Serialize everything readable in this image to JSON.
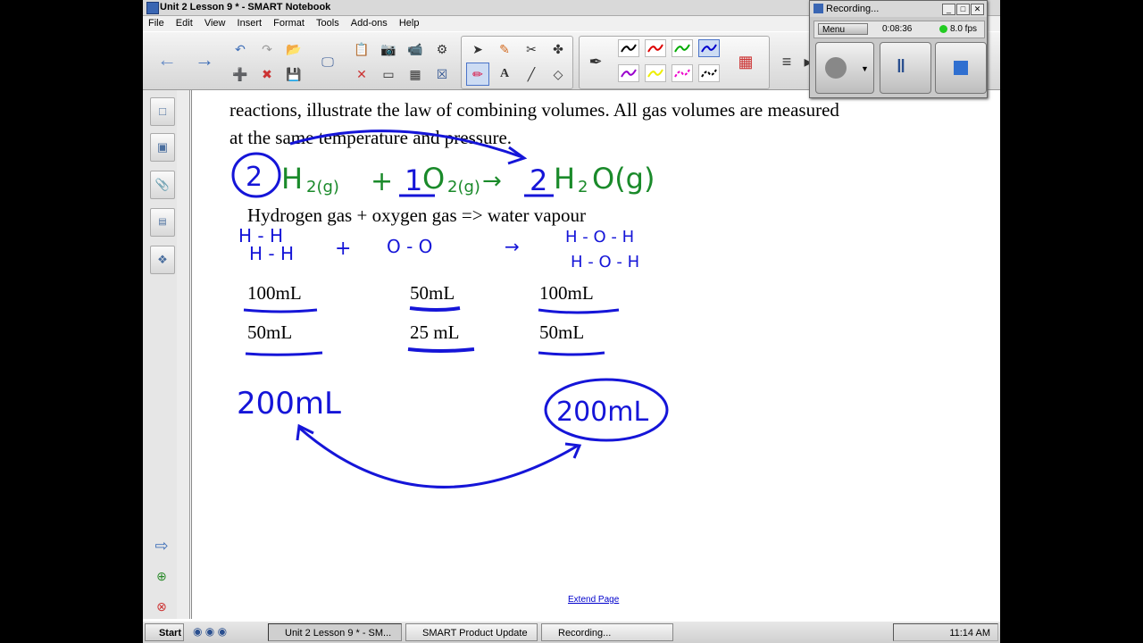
{
  "window": {
    "title": "Unit 2 Lesson 9 * - SMART Notebook"
  },
  "menu": [
    "File",
    "Edit",
    "View",
    "Insert",
    "Format",
    "Tools",
    "Add-ons",
    "Help"
  ],
  "page": {
    "lines": [
      "reactions, illustrate the law of combining volumes.  All gas volumes are measured",
      "at the same temperature and pressure.",
      "Hydrogen gas + oxygen gas => water vapour"
    ],
    "volumes_row1": [
      "100mL",
      "50mL",
      "100mL"
    ],
    "volumes_row2": [
      "50mL",
      "25 mL",
      "50mL"
    ],
    "extend_link": "Extend Page"
  },
  "recorder": {
    "title": "Recording...",
    "menu_label": "Menu",
    "elapsed": "0:08:36",
    "fps": "8.0 fps"
  },
  "taskbar": {
    "start_label": "Start",
    "tasks": [
      "Unit 2 Lesson 9 * - SM...",
      "SMART Product Update",
      "Recording..."
    ],
    "clock": "11:14 AM"
  },
  "colors": {
    "ink_green": "#1a8a2a",
    "ink_blue": "#1515d8",
    "toolbar_bg": "#e4e4e4"
  }
}
